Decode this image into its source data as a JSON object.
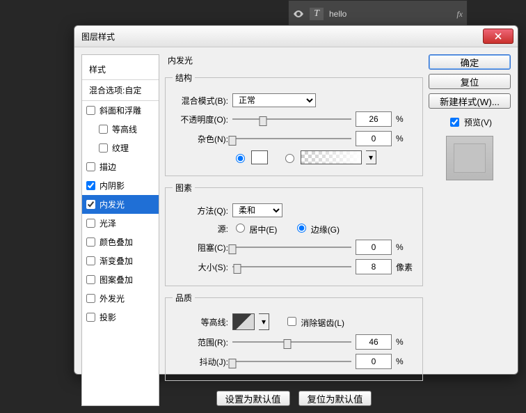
{
  "layers_panel": {
    "layer_name": "hello",
    "fx_label": "fx"
  },
  "dialog": {
    "title": "图层样式",
    "styles": {
      "header": "样式",
      "blend_options": "混合选项:自定",
      "items": [
        {
          "label": "斜面和浮雕",
          "checked": false
        },
        {
          "label": "等高线",
          "checked": false,
          "indent": true
        },
        {
          "label": "纹理",
          "checked": false,
          "indent": true
        },
        {
          "label": "描边",
          "checked": false
        },
        {
          "label": "内阴影",
          "checked": true
        },
        {
          "label": "内发光",
          "checked": true,
          "selected": true
        },
        {
          "label": "光泽",
          "checked": false
        },
        {
          "label": "颜色叠加",
          "checked": false
        },
        {
          "label": "渐变叠加",
          "checked": false
        },
        {
          "label": "图案叠加",
          "checked": false
        },
        {
          "label": "外发光",
          "checked": false
        },
        {
          "label": "投影",
          "checked": false
        }
      ]
    },
    "panel_title": "内发光",
    "structure": {
      "legend": "结构",
      "blend_mode_label": "混合模式(B):",
      "blend_mode_value": "正常",
      "opacity_label": "不透明度(O):",
      "opacity_value": "26",
      "opacity_unit": "%",
      "noise_label": "杂色(N):",
      "noise_value": "0",
      "noise_unit": "%",
      "color_source": "solid",
      "solid_color": "#ffffff"
    },
    "elements": {
      "legend": "图素",
      "technique_label": "方法(Q):",
      "technique_value": "柔和",
      "source_label": "源:",
      "source_center": "居中(E)",
      "source_edge": "边缘(G)",
      "source_value": "edge",
      "choke_label": "阻塞(C):",
      "choke_value": "0",
      "choke_unit": "%",
      "size_label": "大小(S):",
      "size_value": "8",
      "size_unit": "像素"
    },
    "quality": {
      "legend": "品质",
      "contour_label": "等高线:",
      "anti_alias": "消除锯齿(L)",
      "anti_alias_checked": false,
      "range_label": "范围(R):",
      "range_value": "46",
      "range_unit": "%",
      "jitter_label": "抖动(J):",
      "jitter_value": "0",
      "jitter_unit": "%"
    },
    "footer": {
      "set_default": "设置为默认值",
      "reset_default": "复位为默认值"
    },
    "right": {
      "ok": "确定",
      "cancel": "复位",
      "new_style": "新建样式(W)...",
      "preview": "预览(V)",
      "preview_checked": true
    }
  }
}
